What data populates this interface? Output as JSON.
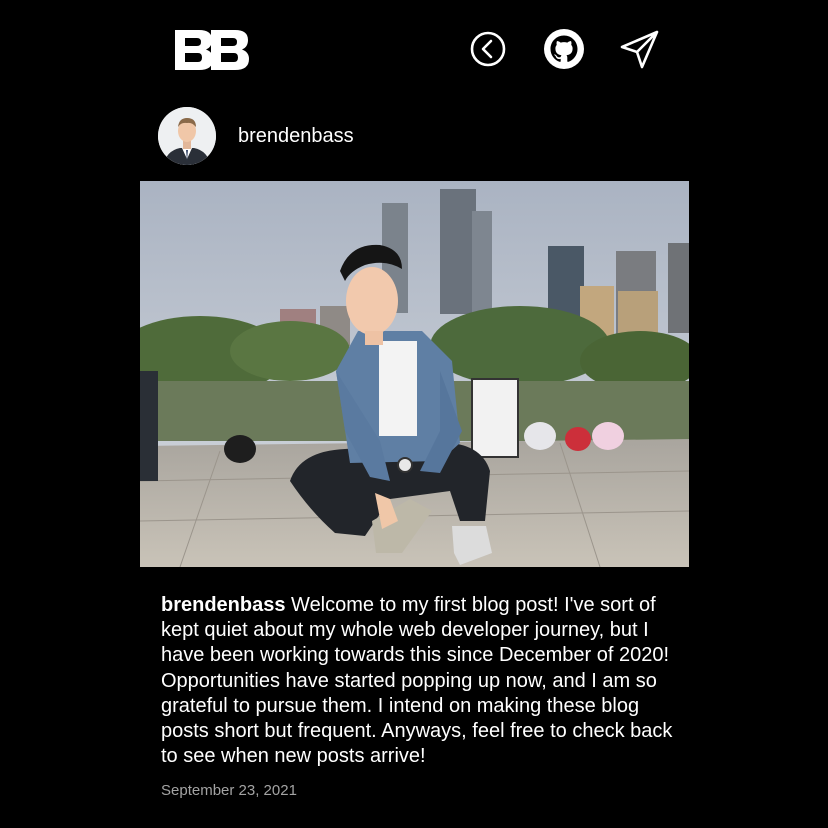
{
  "header": {
    "logo_text": "BB",
    "icons": {
      "back": "back-arrow-circle-icon",
      "github": "github-icon",
      "send": "send-paper-plane-icon"
    }
  },
  "profile": {
    "username": "brendenbass"
  },
  "post": {
    "caption_user": "brendenbass",
    "caption_text": "Welcome to my first blog post! I've sort of kept quiet about my whole web developer journey, but I have been working towards this since December of 2020! Opportunities have started popping up now, and I am so grateful to pursue them. I intend on making these blog posts short but frequent. Anyways, feel free to check back to see when new posts arrive!",
    "date": "September 23, 2021"
  },
  "colors": {
    "background": "#000000",
    "text": "#ffffff",
    "muted": "#a3a3a3"
  }
}
